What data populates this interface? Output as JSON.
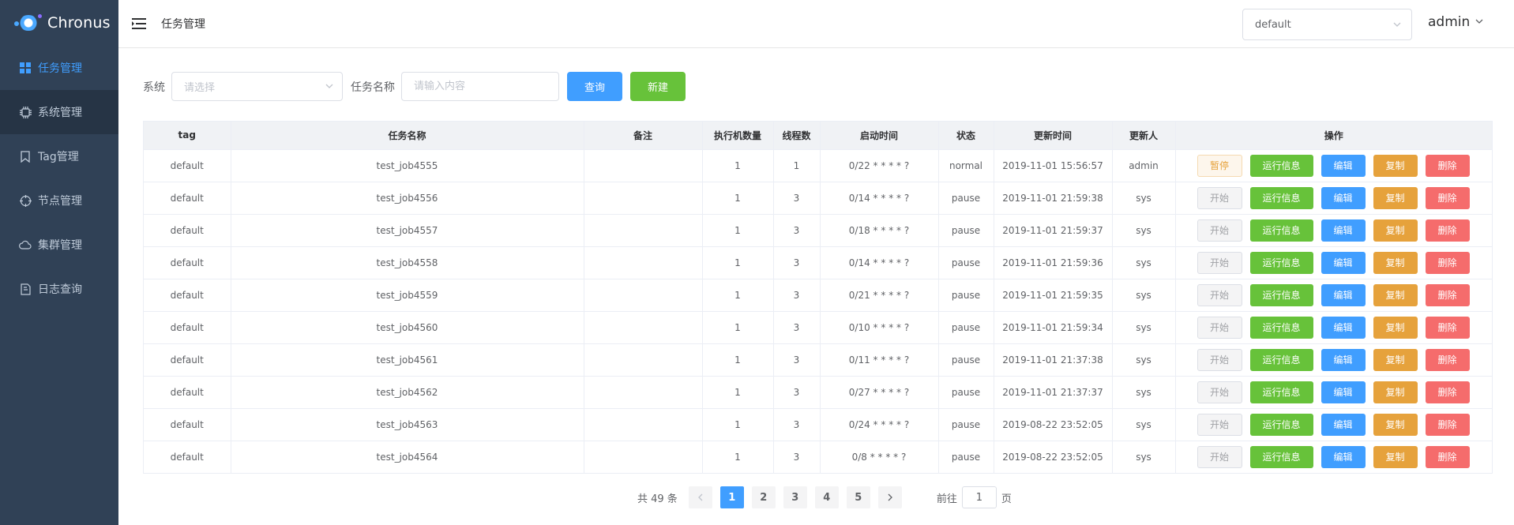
{
  "app": {
    "name": "Chronus"
  },
  "sidebar": {
    "items": [
      {
        "label": "任务管理",
        "icon": "dashboard-icon"
      },
      {
        "label": "系统管理",
        "icon": "chip-icon"
      },
      {
        "label": "Tag管理",
        "icon": "bookmark-icon"
      },
      {
        "label": "节点管理",
        "icon": "target-icon"
      },
      {
        "label": "集群管理",
        "icon": "cloud-icon"
      },
      {
        "label": "日志查询",
        "icon": "log-icon"
      }
    ]
  },
  "header": {
    "breadcrumb": "任务管理",
    "tenant": "default",
    "user": "admin"
  },
  "filter": {
    "system_label": "系统",
    "system_placeholder": "请选择",
    "name_label": "任务名称",
    "name_placeholder": "请输入内容",
    "query_label": "查询",
    "new_label": "新建"
  },
  "table": {
    "columns": [
      "tag",
      "任务名称",
      "备注",
      "执行机数量",
      "线程数",
      "启动时间",
      "状态",
      "更新时间",
      "更新人",
      "操作"
    ],
    "rows": [
      {
        "tag": "default",
        "name": "test_job4555",
        "remark": "",
        "machines": "1",
        "threads": "1",
        "cron": "0/22 * * * * ?",
        "status": "normal",
        "updated": "2019-11-01 15:56:57",
        "updater": "admin",
        "toggle": "暂停"
      },
      {
        "tag": "default",
        "name": "test_job4556",
        "remark": "",
        "machines": "1",
        "threads": "3",
        "cron": "0/14 * * * * ?",
        "status": "pause",
        "updated": "2019-11-01 21:59:38",
        "updater": "sys",
        "toggle": "开始"
      },
      {
        "tag": "default",
        "name": "test_job4557",
        "remark": "",
        "machines": "1",
        "threads": "3",
        "cron": "0/18 * * * * ?",
        "status": "pause",
        "updated": "2019-11-01 21:59:37",
        "updater": "sys",
        "toggle": "开始"
      },
      {
        "tag": "default",
        "name": "test_job4558",
        "remark": "",
        "machines": "1",
        "threads": "3",
        "cron": "0/14 * * * * ?",
        "status": "pause",
        "updated": "2019-11-01 21:59:36",
        "updater": "sys",
        "toggle": "开始"
      },
      {
        "tag": "default",
        "name": "test_job4559",
        "remark": "",
        "machines": "1",
        "threads": "3",
        "cron": "0/21 * * * * ?",
        "status": "pause",
        "updated": "2019-11-01 21:59:35",
        "updater": "sys",
        "toggle": "开始"
      },
      {
        "tag": "default",
        "name": "test_job4560",
        "remark": "",
        "machines": "1",
        "threads": "3",
        "cron": "0/10 * * * * ?",
        "status": "pause",
        "updated": "2019-11-01 21:59:34",
        "updater": "sys",
        "toggle": "开始"
      },
      {
        "tag": "default",
        "name": "test_job4561",
        "remark": "",
        "machines": "1",
        "threads": "3",
        "cron": "0/11 * * * * ?",
        "status": "pause",
        "updated": "2019-11-01 21:37:38",
        "updater": "sys",
        "toggle": "开始"
      },
      {
        "tag": "default",
        "name": "test_job4562",
        "remark": "",
        "machines": "1",
        "threads": "3",
        "cron": "0/27 * * * * ?",
        "status": "pause",
        "updated": "2019-11-01 21:37:37",
        "updater": "sys",
        "toggle": "开始"
      },
      {
        "tag": "default",
        "name": "test_job4563",
        "remark": "",
        "machines": "1",
        "threads": "3",
        "cron": "0/24 * * * * ?",
        "status": "pause",
        "updated": "2019-08-22 23:52:05",
        "updater": "sys",
        "toggle": "开始"
      },
      {
        "tag": "default",
        "name": "test_job4564",
        "remark": "",
        "machines": "1",
        "threads": "3",
        "cron": "0/8 * * * * ?",
        "status": "pause",
        "updated": "2019-08-22 23:52:05",
        "updater": "sys",
        "toggle": "开始"
      }
    ],
    "actions": {
      "run": "运行信息",
      "edit": "编辑",
      "copy": "复制",
      "delete": "删除"
    }
  },
  "pagination": {
    "total": "共 49 条",
    "pages": [
      "1",
      "2",
      "3",
      "4",
      "5"
    ],
    "current": "1",
    "goto_prefix": "前往",
    "goto_value": "1",
    "goto_suffix": "页"
  },
  "colors": {
    "primary": "#409eff",
    "success": "#67c23a",
    "warning": "#e6a23c",
    "danger": "#f56c6c",
    "sidebar": "#304156"
  }
}
